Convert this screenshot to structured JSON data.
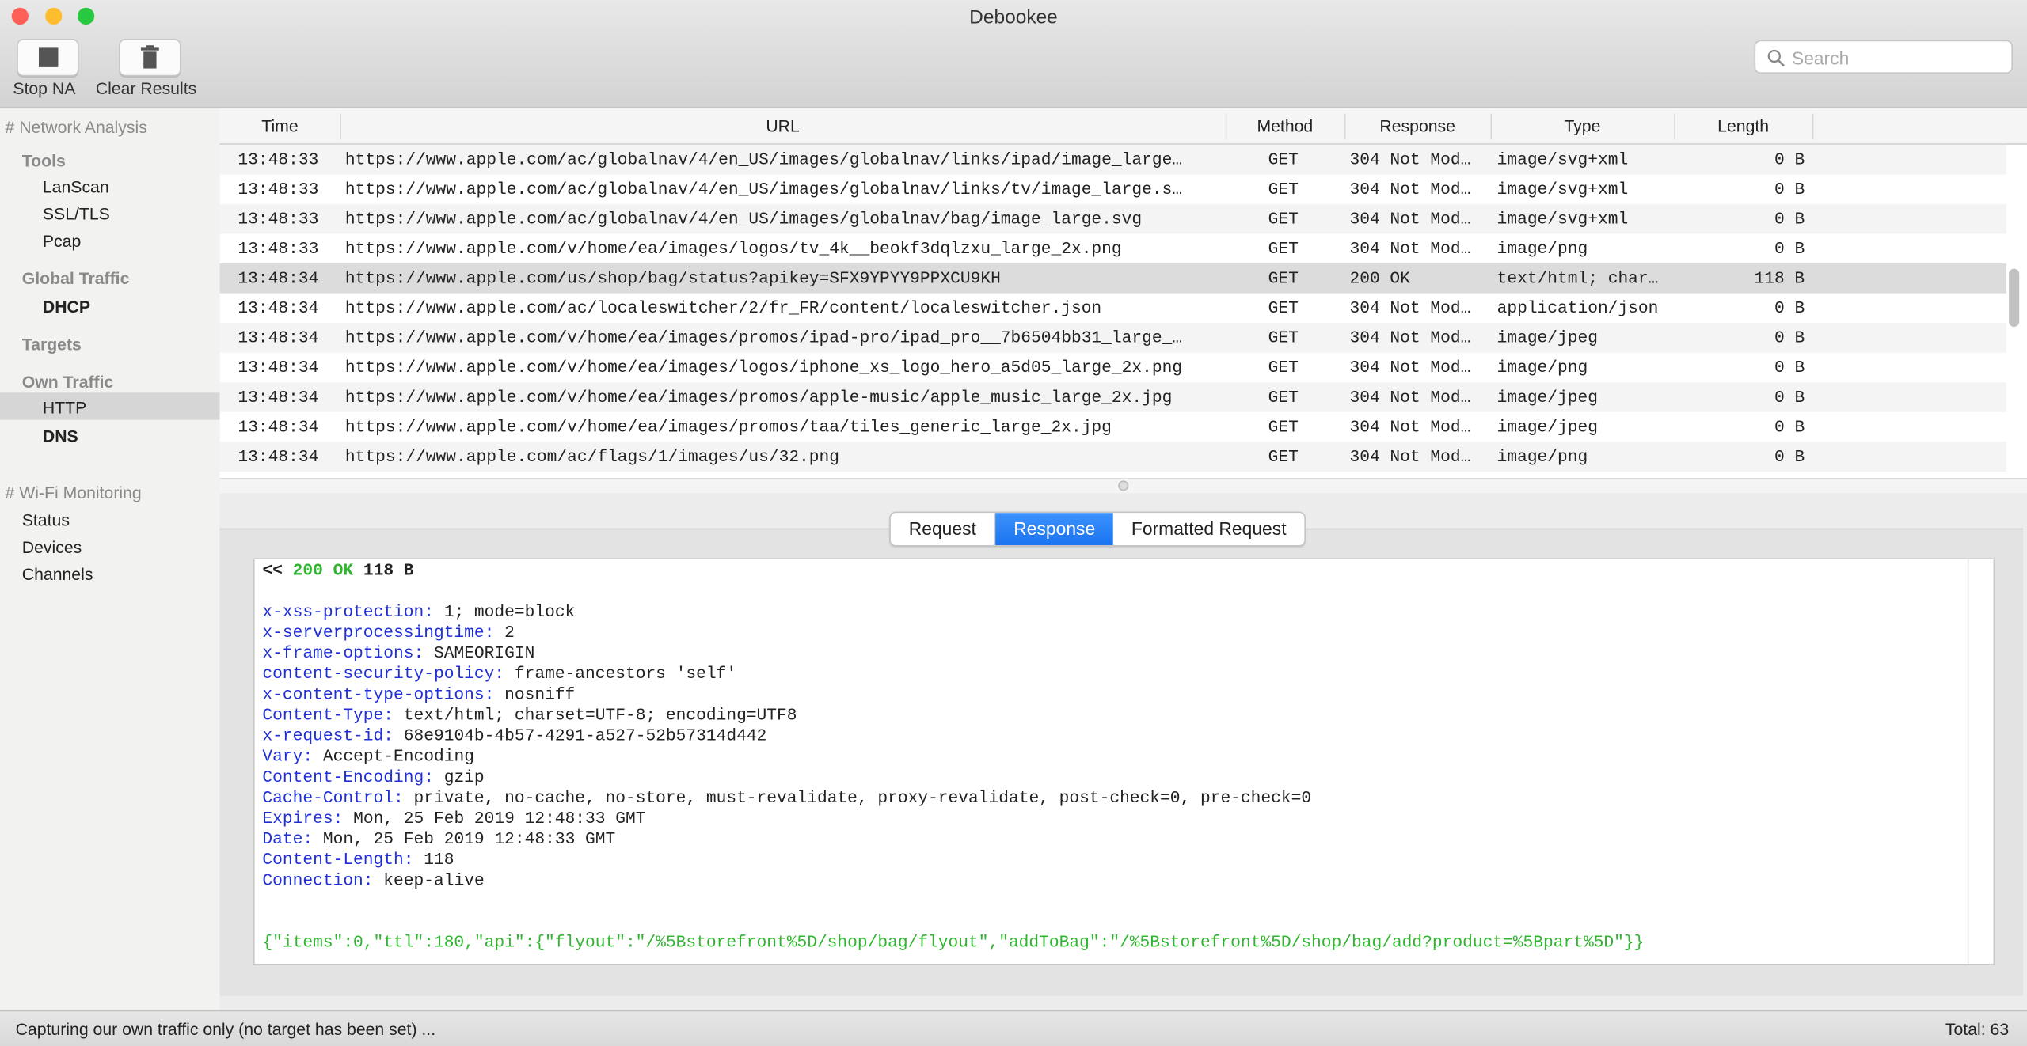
{
  "window": {
    "title": "Debookee"
  },
  "toolbar": {
    "stop_label": "Stop NA",
    "clear_label": "Clear Results",
    "search_placeholder": "Search"
  },
  "sidebar": {
    "network_analysis": "# Network Analysis",
    "tools": "Tools",
    "lanscan": "LanScan",
    "ssltls": "SSL/TLS",
    "pcap": "Pcap",
    "global_traffic": "Global Traffic",
    "dhcp": "DHCP",
    "targets": "Targets",
    "own_traffic": "Own Traffic",
    "http": "HTTP",
    "dns": "DNS",
    "wifi_monitoring": "# Wi-Fi Monitoring",
    "status": "Status",
    "devices": "Devices",
    "channels": "Channels"
  },
  "table": {
    "columns": [
      "Time",
      "URL",
      "Method",
      "Response",
      "Type",
      "Length"
    ],
    "selected_index": 4,
    "rows": [
      [
        "13:48:33",
        "https://www.apple.com/ac/globalnav/4/en_US/images/globalnav/links/ipad/image_large…",
        "GET",
        "304 Not Mod…",
        "image/svg+xml",
        "0 B"
      ],
      [
        "13:48:33",
        "https://www.apple.com/ac/globalnav/4/en_US/images/globalnav/links/tv/image_large.s…",
        "GET",
        "304 Not Mod…",
        "image/svg+xml",
        "0 B"
      ],
      [
        "13:48:33",
        "https://www.apple.com/ac/globalnav/4/en_US/images/globalnav/bag/image_large.svg",
        "GET",
        "304 Not Mod…",
        "image/svg+xml",
        "0 B"
      ],
      [
        "13:48:33",
        "https://www.apple.com/v/home/ea/images/logos/tv_4k__beokf3dqlzxu_large_2x.png",
        "GET",
        "304 Not Mod…",
        "image/png",
        "0 B"
      ],
      [
        "13:48:34",
        "https://www.apple.com/us/shop/bag/status?apikey=SFX9YPYY9PPXCU9KH",
        "GET",
        "200 OK",
        "text/html; char…",
        "118 B"
      ],
      [
        "13:48:34",
        "https://www.apple.com/ac/localeswitcher/2/fr_FR/content/localeswitcher.json",
        "GET",
        "304 Not Mod…",
        "application/json",
        "0 B"
      ],
      [
        "13:48:34",
        "https://www.apple.com/v/home/ea/images/promos/ipad-pro/ipad_pro__7b6504bb31_large_…",
        "GET",
        "304 Not Mod…",
        "image/jpeg",
        "0 B"
      ],
      [
        "13:48:34",
        "https://www.apple.com/v/home/ea/images/logos/iphone_xs_logo_hero_a5d05_large_2x.png",
        "GET",
        "304 Not Mod…",
        "image/png",
        "0 B"
      ],
      [
        "13:48:34",
        "https://www.apple.com/v/home/ea/images/promos/apple-music/apple_music_large_2x.jpg",
        "GET",
        "304 Not Mod…",
        "image/jpeg",
        "0 B"
      ],
      [
        "13:48:34",
        "https://www.apple.com/v/home/ea/images/promos/taa/tiles_generic_large_2x.jpg",
        "GET",
        "304 Not Mod…",
        "image/jpeg",
        "0 B"
      ],
      [
        "13:48:34",
        "https://www.apple.com/ac/flags/1/images/us/32.png",
        "GET",
        "304 Not Mod…",
        "image/png",
        "0 B"
      ]
    ]
  },
  "detail": {
    "tabs": [
      "Request",
      "Response",
      "Formatted Request"
    ],
    "active_tab": "Response",
    "status_prefix": "<<",
    "status_code": "200 OK",
    "status_size": "118 B",
    "headers": [
      [
        "x-xss-protection:",
        "1; mode=block"
      ],
      [
        "x-serverprocessingtime:",
        "2"
      ],
      [
        "x-frame-options:",
        "SAMEORIGIN"
      ],
      [
        "content-security-policy:",
        "frame-ancestors 'self'"
      ],
      [
        "x-content-type-options:",
        "nosniff"
      ],
      [
        "Content-Type:",
        "text/html; charset=UTF-8; encoding=UTF8"
      ],
      [
        "x-request-id:",
        "68e9104b-4b57-4291-a527-52b57314d442"
      ],
      [
        "Vary:",
        "Accept-Encoding"
      ],
      [
        "Content-Encoding:",
        "gzip"
      ],
      [
        "Cache-Control:",
        "private, no-cache, no-store, must-revalidate, proxy-revalidate, post-check=0, pre-check=0"
      ],
      [
        "Expires:",
        "Mon, 25 Feb 2019 12:48:33 GMT"
      ],
      [
        "Date:",
        "Mon, 25 Feb 2019 12:48:33 GMT"
      ],
      [
        "Content-Length:",
        "118"
      ],
      [
        "Connection:",
        "keep-alive"
      ]
    ],
    "body": "{\"items\":0,\"ttl\":180,\"api\":{\"flyout\":\"/%5Bstorefront%5D/shop/bag/flyout\",\"addToBag\":\"/%5Bstorefront%5D/shop/bag/add?product=%5Bpart%5D\"}}"
  },
  "statusbar": {
    "message": "Capturing our own traffic only (no target has been set) ...",
    "total": "Total: 63"
  },
  "colors": {
    "accent": "#1a74f2",
    "header_key": "#1f2fd8",
    "ok_green": "#2fb52f",
    "selected_row": "#dcdcdc"
  }
}
